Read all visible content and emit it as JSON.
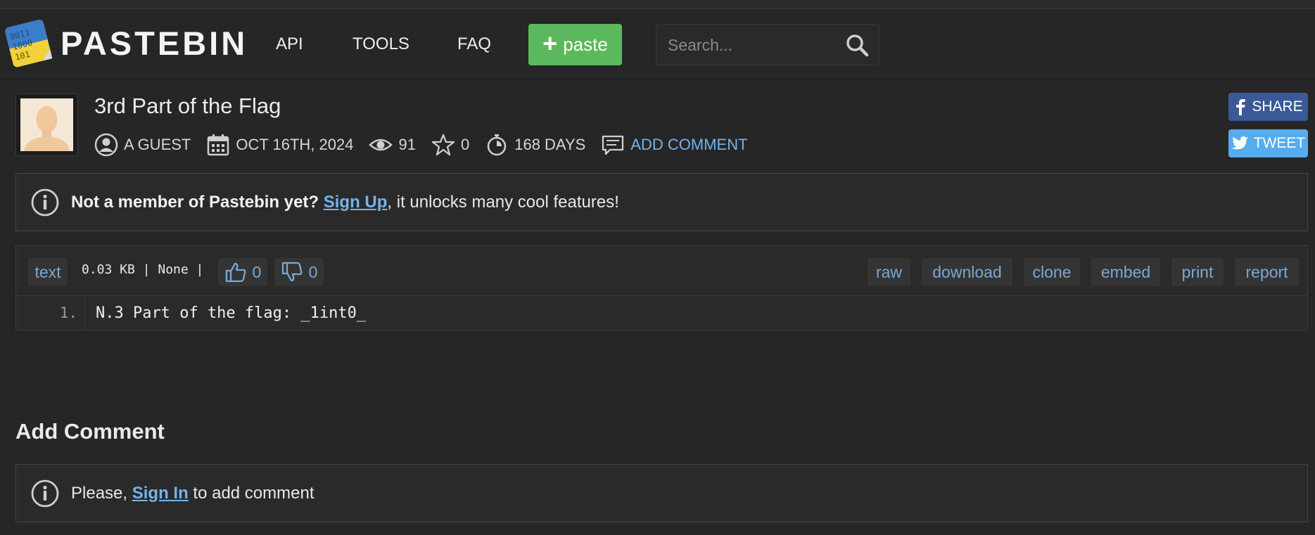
{
  "header": {
    "logo_text": "PASTEBIN",
    "nav": [
      "API",
      "TOOLS",
      "FAQ"
    ],
    "paste_button": "paste",
    "search_placeholder": "Search..."
  },
  "post": {
    "title": "3rd Part of the Flag",
    "author": "A GUEST",
    "date": "OCT 16TH, 2024",
    "views": "91",
    "stars": "0",
    "expires": "168 DAYS",
    "add_comment": "ADD COMMENT"
  },
  "social": {
    "share": "SHARE",
    "tweet": "TWEET"
  },
  "member_notice": {
    "bold": "Not a member of Pastebin yet?",
    "link": "Sign Up",
    "rest": ", it unlocks many cool features!"
  },
  "code": {
    "syntax": "text",
    "size": "0.03 KB | None |",
    "likes": "0",
    "dislikes": "0",
    "actions": [
      "raw",
      "download",
      "clone",
      "embed",
      "print",
      "report"
    ],
    "lines": [
      {
        "number": "1.",
        "text": "N.3 Part of the flag: _1int0_"
      }
    ]
  },
  "comments": {
    "title": "Add Comment",
    "prefix": "Please,",
    "link": "Sign In",
    "suffix": "to add comment"
  },
  "colors": {
    "accent_green": "#5cb85c",
    "link_blue": "#73b3ea",
    "facebook": "#3b5998",
    "twitter": "#55acee"
  }
}
